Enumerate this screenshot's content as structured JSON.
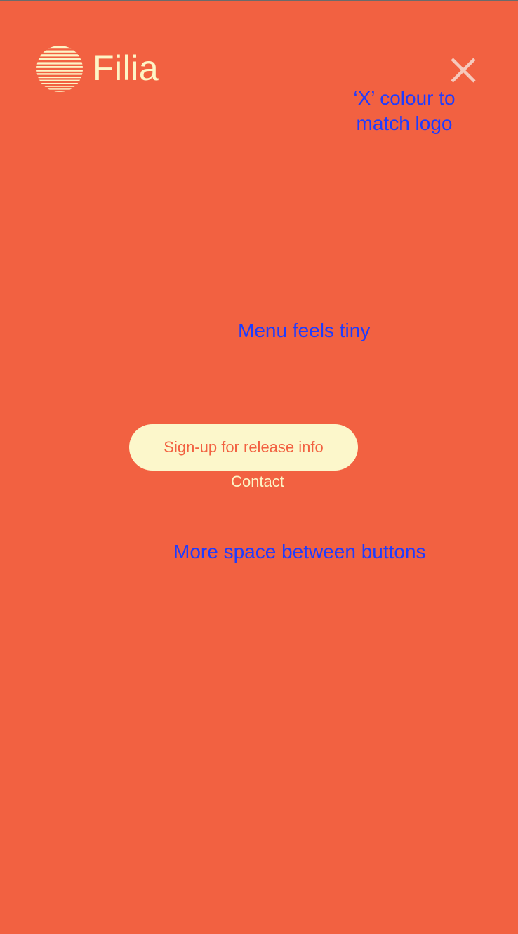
{
  "brand": {
    "name": "Filia",
    "logo_icon": "striped-sun-icon",
    "text_color": "#FDF5C6"
  },
  "header": {
    "close_icon": "close-icon",
    "close_color": "#F6C9BC"
  },
  "menu": {
    "signup_label": "Sign-up for release info",
    "contact_label": "Contact"
  },
  "annotations": {
    "x_colour": "‘X’ colour to match logo",
    "menu_size": "Menu feels tiny",
    "button_spacing": "More space between buttons"
  },
  "colors": {
    "background": "#F26141",
    "button_fill": "#FCF7CB",
    "annotation": "#1E3CFF"
  }
}
